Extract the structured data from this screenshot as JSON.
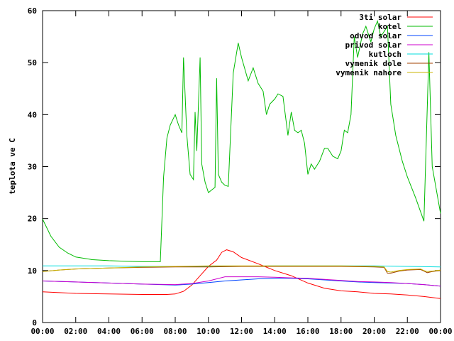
{
  "chart_data": {
    "type": "line",
    "title": "",
    "xlabel": "",
    "ylabel": "teplota ve C",
    "xlim": [
      0,
      24
    ],
    "ylim": [
      0,
      60
    ],
    "x_ticks": [
      {
        "v": 0,
        "label": "00:00"
      },
      {
        "v": 2,
        "label": "02:00"
      },
      {
        "v": 4,
        "label": "04:00"
      },
      {
        "v": 6,
        "label": "06:00"
      },
      {
        "v": 8,
        "label": "08:00"
      },
      {
        "v": 10,
        "label": "10:00"
      },
      {
        "v": 12,
        "label": "12:00"
      },
      {
        "v": 14,
        "label": "14:00"
      },
      {
        "v": 16,
        "label": "16:00"
      },
      {
        "v": 18,
        "label": "18:00"
      },
      {
        "v": 20,
        "label": "20:00"
      },
      {
        "v": 22,
        "label": "22:00"
      },
      {
        "v": 24,
        "label": "00:00"
      }
    ],
    "y_ticks": [
      {
        "v": 0,
        "label": "0"
      },
      {
        "v": 10,
        "label": "10"
      },
      {
        "v": 20,
        "label": "20"
      },
      {
        "v": 30,
        "label": "30"
      },
      {
        "v": 40,
        "label": "40"
      },
      {
        "v": 50,
        "label": "50"
      },
      {
        "v": 60,
        "label": "60"
      }
    ],
    "grid": false,
    "legend_position": "top-right",
    "series": [
      {
        "name": "3ti solar",
        "color": "#ff0000",
        "points": [
          [
            0,
            5.9
          ],
          [
            2,
            5.6
          ],
          [
            4,
            5.5
          ],
          [
            6,
            5.4
          ],
          [
            7.5,
            5.4
          ],
          [
            8,
            5.5
          ],
          [
            8.5,
            6
          ],
          [
            9,
            7.2
          ],
          [
            9.5,
            9
          ],
          [
            10,
            10.8
          ],
          [
            10.5,
            12
          ],
          [
            10.8,
            13.5
          ],
          [
            11.1,
            14
          ],
          [
            11.5,
            13.6
          ],
          [
            12,
            12.5
          ],
          [
            13,
            11.3
          ],
          [
            14,
            10
          ],
          [
            15,
            9
          ],
          [
            16,
            7.6
          ],
          [
            17,
            6.6
          ],
          [
            18,
            6.1
          ],
          [
            19,
            5.9
          ],
          [
            20,
            5.6
          ],
          [
            21,
            5.5
          ],
          [
            22,
            5.3
          ],
          [
            23,
            5.0
          ],
          [
            24,
            4.6
          ]
        ]
      },
      {
        "name": "kotel",
        "color": "#00bb00",
        "points": [
          [
            0,
            19.9
          ],
          [
            0.5,
            16.6
          ],
          [
            1,
            14.5
          ],
          [
            1.5,
            13.4
          ],
          [
            2,
            12.6
          ],
          [
            3,
            12.1
          ],
          [
            4,
            11.9
          ],
          [
            5,
            11.8
          ],
          [
            6,
            11.7
          ],
          [
            7.1,
            11.7
          ],
          [
            7.3,
            28
          ],
          [
            7.5,
            35.5
          ],
          [
            7.7,
            38
          ],
          [
            8,
            40
          ],
          [
            8.2,
            38
          ],
          [
            8.4,
            36.5
          ],
          [
            8.5,
            51
          ],
          [
            8.7,
            36
          ],
          [
            8.9,
            28.5
          ],
          [
            9.1,
            27.5
          ],
          [
            9.2,
            40.5
          ],
          [
            9.3,
            33
          ],
          [
            9.5,
            51
          ],
          [
            9.6,
            30.5
          ],
          [
            9.8,
            27
          ],
          [
            10,
            25
          ],
          [
            10.2,
            25.5
          ],
          [
            10.4,
            26
          ],
          [
            10.5,
            47
          ],
          [
            10.6,
            28.5
          ],
          [
            10.8,
            27
          ],
          [
            11,
            26.4
          ],
          [
            11.2,
            26.2
          ],
          [
            11.5,
            48
          ],
          [
            11.8,
            53.8
          ],
          [
            12,
            51
          ],
          [
            12.4,
            46.5
          ],
          [
            12.7,
            49
          ],
          [
            13,
            46
          ],
          [
            13.3,
            44.5
          ],
          [
            13.5,
            40
          ],
          [
            13.7,
            42
          ],
          [
            14,
            43
          ],
          [
            14.2,
            44
          ],
          [
            14.5,
            43.5
          ],
          [
            14.8,
            36
          ],
          [
            15,
            40.5
          ],
          [
            15.2,
            37
          ],
          [
            15.4,
            36.5
          ],
          [
            15.6,
            37
          ],
          [
            15.8,
            34.5
          ],
          [
            16,
            28.5
          ],
          [
            16.2,
            30.5
          ],
          [
            16.4,
            29.5
          ],
          [
            16.7,
            31
          ],
          [
            17,
            33.5
          ],
          [
            17.2,
            33.5
          ],
          [
            17.5,
            32
          ],
          [
            17.8,
            31.5
          ],
          [
            18,
            33
          ],
          [
            18.2,
            37
          ],
          [
            18.4,
            36.5
          ],
          [
            18.6,
            40
          ],
          [
            18.8,
            55
          ],
          [
            19,
            51
          ],
          [
            19.3,
            55.5
          ],
          [
            19.5,
            57
          ],
          [
            19.8,
            54
          ],
          [
            20,
            56.5
          ],
          [
            20.2,
            58
          ],
          [
            20.4,
            55
          ],
          [
            20.6,
            56
          ],
          [
            20.8,
            57
          ],
          [
            21,
            42
          ],
          [
            21.3,
            36
          ],
          [
            21.7,
            31
          ],
          [
            22,
            28
          ],
          [
            22.5,
            24
          ],
          [
            23,
            19.5
          ],
          [
            23.3,
            52
          ],
          [
            23.5,
            30
          ],
          [
            24,
            21
          ]
        ]
      },
      {
        "name": "odvod solar",
        "color": "#0044ff",
        "points": [
          [
            0,
            8
          ],
          [
            2,
            7.8
          ],
          [
            4,
            7.6
          ],
          [
            6,
            7.4
          ],
          [
            8,
            7.2
          ],
          [
            9,
            7.4
          ],
          [
            10,
            7.7
          ],
          [
            11,
            8
          ],
          [
            12,
            8.2
          ],
          [
            13,
            8.4
          ],
          [
            14,
            8.5
          ],
          [
            15,
            8.5
          ],
          [
            16,
            8.4
          ],
          [
            17,
            8.2
          ],
          [
            18,
            8
          ],
          [
            19,
            7.8
          ],
          [
            20,
            7.7
          ],
          [
            21,
            7.6
          ],
          [
            22,
            7.5
          ],
          [
            23,
            7.3
          ],
          [
            24,
            7
          ]
        ]
      },
      {
        "name": "privod solar",
        "color": "#cc00cc",
        "points": [
          [
            0,
            8
          ],
          [
            2,
            7.8
          ],
          [
            4,
            7.6
          ],
          [
            6,
            7.4
          ],
          [
            8,
            7.3
          ],
          [
            9,
            7.5
          ],
          [
            10,
            8
          ],
          [
            11,
            8.8
          ],
          [
            12,
            8.8
          ],
          [
            13,
            8.8
          ],
          [
            14,
            8.7
          ],
          [
            15,
            8.6
          ],
          [
            16,
            8.5
          ],
          [
            17,
            8.3
          ],
          [
            18,
            8.1
          ],
          [
            19,
            7.9
          ],
          [
            20,
            7.8
          ],
          [
            21,
            7.7
          ],
          [
            22,
            7.5
          ],
          [
            23,
            7.3
          ],
          [
            24,
            7
          ]
        ]
      },
      {
        "name": "kutloch",
        "color": "#00dddd",
        "points": [
          [
            0,
            10.9
          ],
          [
            2,
            10.9
          ],
          [
            4,
            10.9
          ],
          [
            6,
            10.8
          ],
          [
            8,
            10.8
          ],
          [
            10,
            10.8
          ],
          [
            12,
            10.8
          ],
          [
            14,
            10.9
          ],
          [
            16,
            10.9
          ],
          [
            18,
            10.9
          ],
          [
            20,
            10.9
          ],
          [
            22,
            10.8
          ],
          [
            24,
            10.7
          ]
        ]
      },
      {
        "name": "vymenik dole",
        "color": "#a04000",
        "points": [
          [
            0,
            9.8
          ],
          [
            1,
            10.1
          ],
          [
            2,
            10.3
          ],
          [
            4,
            10.5
          ],
          [
            6,
            10.6
          ],
          [
            8,
            10.7
          ],
          [
            10,
            10.7
          ],
          [
            12,
            10.8
          ],
          [
            14,
            10.8
          ],
          [
            16,
            10.8
          ],
          [
            18,
            10.8
          ],
          [
            20,
            10.7
          ],
          [
            20.6,
            10.6
          ],
          [
            20.8,
            9.5
          ],
          [
            21,
            9.5
          ],
          [
            21.5,
            9.9
          ],
          [
            22,
            10.1
          ],
          [
            22.8,
            10.2
          ],
          [
            23,
            9.9
          ],
          [
            23.2,
            9.6
          ],
          [
            23.5,
            9.8
          ],
          [
            24,
            10
          ]
        ]
      },
      {
        "name": "vymenik nahore",
        "color": "#c8b400",
        "points": [
          [
            0,
            9.8
          ],
          [
            1,
            10.1
          ],
          [
            2,
            10.3
          ],
          [
            4,
            10.5
          ],
          [
            6,
            10.7
          ],
          [
            8,
            10.8
          ],
          [
            10,
            10.9
          ],
          [
            12,
            10.9
          ],
          [
            14,
            10.9
          ],
          [
            16,
            10.9
          ],
          [
            18,
            10.9
          ],
          [
            20,
            10.8
          ],
          [
            20.6,
            10.7
          ],
          [
            20.8,
            9.8
          ],
          [
            21,
            9.7
          ],
          [
            21.5,
            10
          ],
          [
            22,
            10.2
          ],
          [
            22.8,
            10.3
          ],
          [
            23,
            10
          ],
          [
            23.2,
            9.8
          ],
          [
            23.5,
            9.9
          ],
          [
            24,
            10.1
          ]
        ]
      }
    ]
  }
}
